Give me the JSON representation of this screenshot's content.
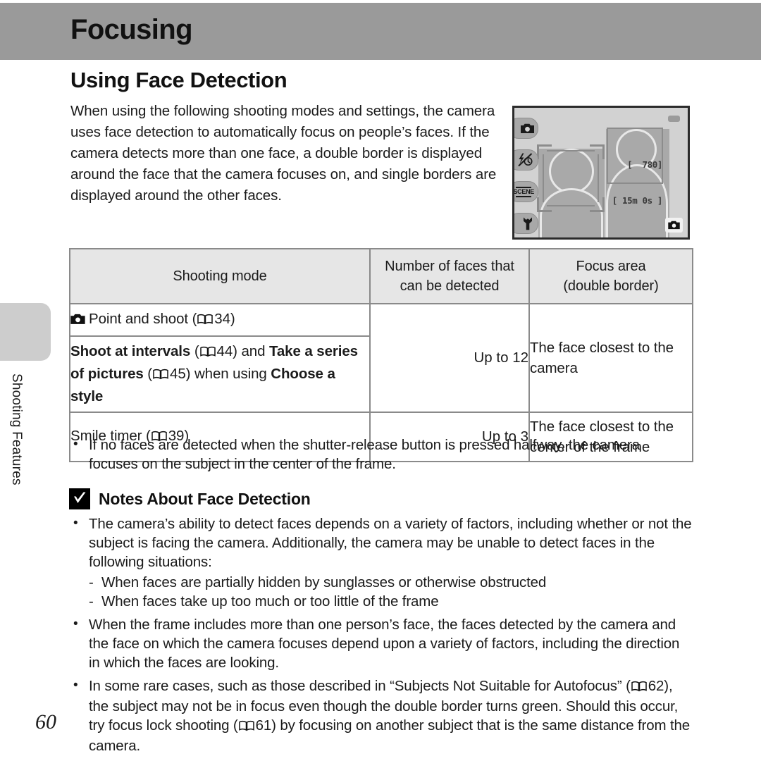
{
  "header": {
    "title": "Focusing"
  },
  "section": {
    "title": "Using Face Detection",
    "intro": "When using the following shooting modes and settings, the camera uses face detection to automatically focus on people’s faces. If the camera detects more than one face, a double border is displayed around the face that the camera focuses on, and single borders are displayed around the other faces."
  },
  "lcd": {
    "icons": [
      "camera-mode-icon",
      "flash-self-timer-icon",
      "scene-icon",
      "wrench-setup-icon"
    ],
    "scene_label": "SCENE",
    "counter_shots": "[  780]",
    "counter_time": "[ 15m 0s ]",
    "mode_icon": "camera-icon",
    "battery_icon": "battery-icon"
  },
  "table": {
    "headers": {
      "col1": "Shooting mode",
      "col2_line1": "Number of faces that",
      "col2_line2": "can be detected",
      "col3_line1": "Focus area",
      "col3_line2": "(double border)"
    },
    "rows": [
      {
        "mode_icon": "camera-icon",
        "mode_text": "Point and shoot (",
        "mode_ref_page": "34",
        "mode_suffix": ")"
      },
      {
        "mode_bold_1": "Shoot at intervals",
        "mode_ref_1": "44",
        "mode_mid": ") and ",
        "mode_bold_2": "Take a series of pictures",
        "mode_ref_2": "45",
        "mode_mid_2": ") when using ",
        "mode_bold_3": "Choose a style"
      },
      {
        "mode_text": "Smile timer (",
        "mode_ref_page": "39",
        "mode_suffix": ")"
      }
    ],
    "faces_merged": "Up to 12",
    "faces_row3": "Up to 3",
    "area_merged_line1": "The face closest to the",
    "area_merged_line2": "camera",
    "area_row3_line1": "The face closest to the",
    "area_row3_line2": "center of the frame"
  },
  "bullets_top": [
    "If no faces are detected when the shutter-release button is pressed halfway, the camera focuses on the subject in the center of the frame."
  ],
  "notes": {
    "icon": "caution-check-icon",
    "heading": "Notes About Face Detection",
    "bullet1": "The camera’s ability to detect faces depends on a variety of factors, including whether or not the subject is facing the camera. Additionally, the camera may be unable to detect faces in the following situations:",
    "dash1": "When faces are partially hidden by sunglasses or otherwise obstructed",
    "dash2": "When faces take up too much or too little of the frame",
    "bullet2": "When the frame includes more than one person’s face, the faces detected by the camera and the face on which the camera focuses depend upon a variety of factors, including the direction in which the faces are looking.",
    "bullet3_part1": "In some rare cases, such as those described in “Subjects Not Suitable for Autofocus” (",
    "bullet3_ref1": "62",
    "bullet3_part2": "), the subject may not be in focus even though the double border turns green. Should this occur, try focus lock shooting (",
    "bullet3_ref2": "61",
    "bullet3_part3": ") by focusing on another subject that is the same distance from the camera."
  },
  "side_tab": {
    "label": "Shooting Features"
  },
  "page_number": "60",
  "colors": {
    "header_band": "#9a9a9a",
    "table_header_fill": "#e6e6e6",
    "table_border": "#8a8a8a",
    "side_tab": "#cdcdcd",
    "lcd_background": "#d2d2d2"
  }
}
